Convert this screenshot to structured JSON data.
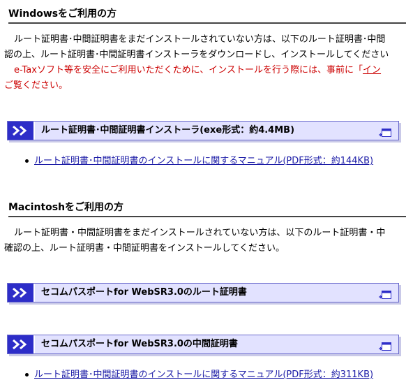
{
  "windows": {
    "heading": "Windowsをご利用の方",
    "para_line1": "ルート証明書･中間証明書をまだインストールされていない方は、以下のルート証明書･中間",
    "para_line2": "認の上、ルート証明書･中間証明書インストーラをダウンロードし、インストールしてください",
    "red_line1_prefix": "e-Taxソフト等を安全にご利用いただくために、インストールを行う際には、事前に「",
    "red_line1_link": "イン",
    "red_line2": "ご覧ください。",
    "download_label": "ルート証明書･中間証明書インストーラ(exe形式：約4.4MB)",
    "manual_link": "ルート証明書･中間証明書のインストールに関するマニュアル(PDF形式：約144KB)"
  },
  "mac": {
    "heading": "Macintoshをご利用の方",
    "para_line1": "ルート証明書・中間証明書をまだインストールされていない方は、以下のルート証明書・中",
    "para_line2": "確認の上、ルート証明書・中間証明書をインストールしてください。",
    "download1_label": "セコムパスポートfor WebSR3.0のルート証明書",
    "download2_label": "セコムパスポートfor WebSR3.0の中間証明書",
    "manual_link": "ルート証明書･中間証明書のインストールに関するマニュアル(PDF形式：約311KB)"
  },
  "icons": {
    "bar_chevron": "double-chevron-right-icon",
    "new_window": "new-window-icon",
    "bullet": "bullet-dot"
  },
  "colors": {
    "bar_accent": "#2d2dc8",
    "bar_background": "#e2e2ff",
    "notice_red": "#cc0000",
    "link_blue": "#1a1aa6"
  }
}
